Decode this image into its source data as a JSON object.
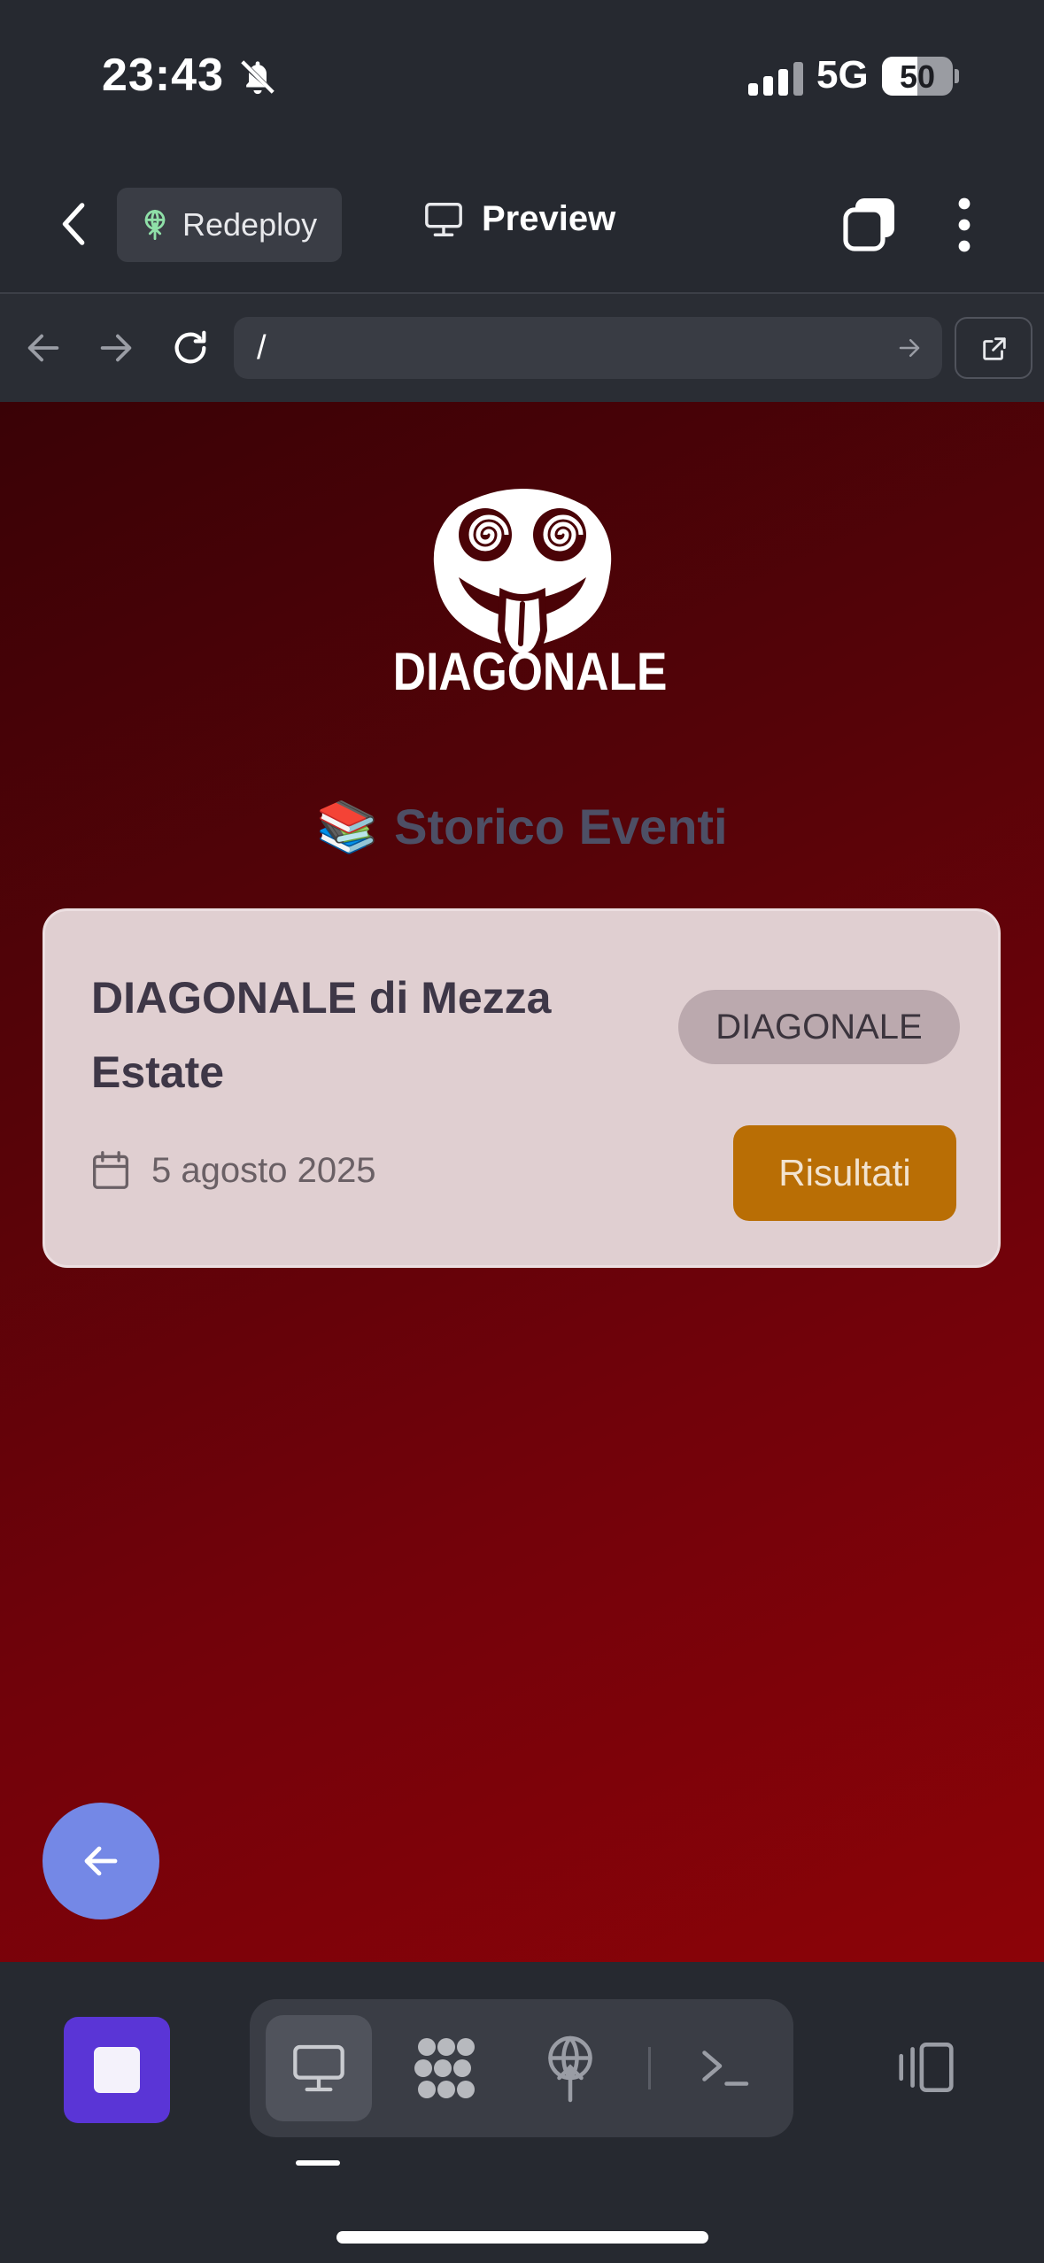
{
  "status_bar": {
    "time": "23:43",
    "network": "5G",
    "battery": "50",
    "battery_level": 0.5
  },
  "header": {
    "redeploy_label": "Redeploy",
    "preview_label": "Preview"
  },
  "browser": {
    "url": "/"
  },
  "page": {
    "logo_text": "DIAGONALE",
    "heading_emoji": "📚",
    "heading": "Storico Eventi",
    "event": {
      "title": "DIAGONALE di Mezza Estate",
      "badge": "DIAGONALE",
      "date": "5 agosto 2025",
      "results_label": "Risultati"
    }
  },
  "colors": {
    "accent_purple": "#5a35d6",
    "results_orange": "#b96e05",
    "fab_blue": "#7488e6",
    "background_red": "#72020a"
  },
  "icons": [
    "bell-slash-icon",
    "chevron-left-icon",
    "sprout-icon",
    "monitor-icon",
    "tabs-icon",
    "kebab-icon",
    "arrow-left-icon",
    "arrow-right-icon",
    "reload-icon",
    "external-link-icon",
    "calendar-icon",
    "stop-icon",
    "grid-icon",
    "globe-upload-icon",
    "terminal-icon",
    "panel-icon"
  ]
}
